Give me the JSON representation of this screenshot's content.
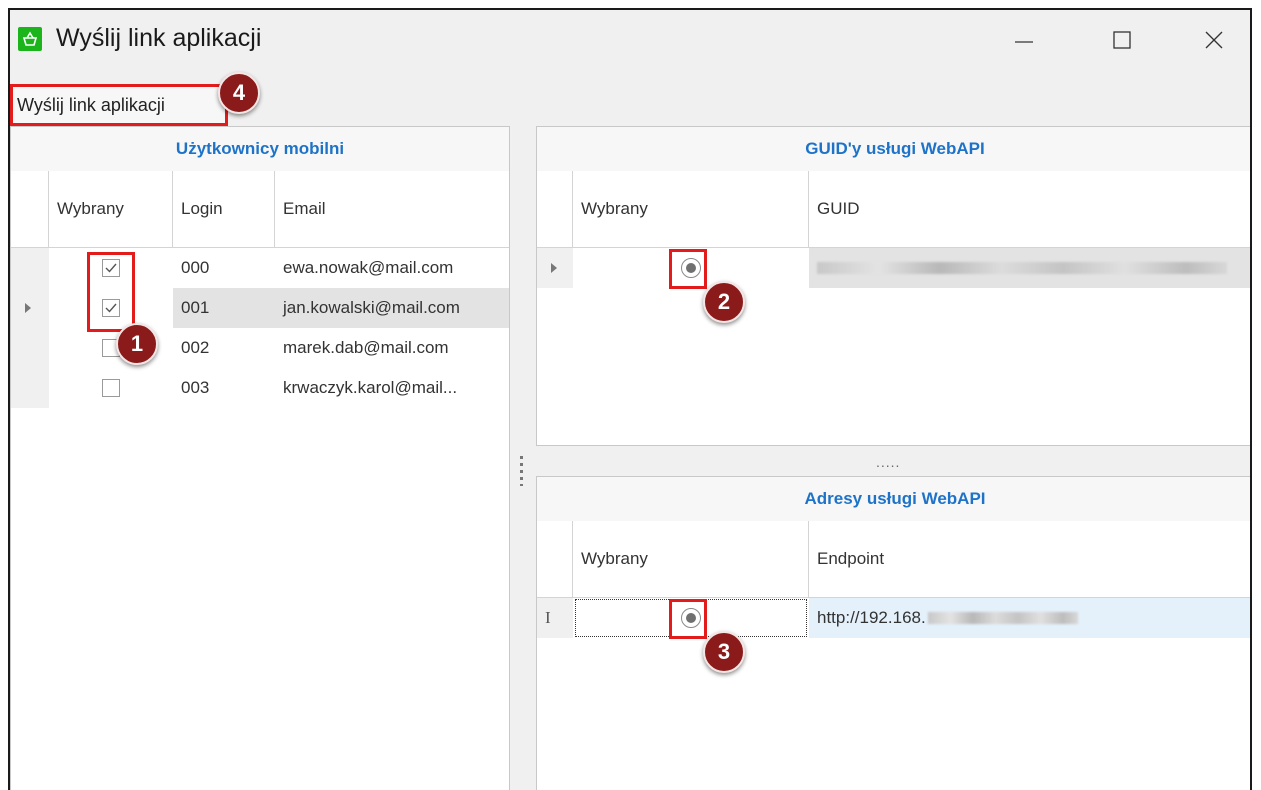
{
  "window": {
    "title": "Wyślij link aplikacji",
    "controls": {
      "minimize": "—",
      "maximize": "☐",
      "close": "✕"
    }
  },
  "toolbar": {
    "send_link_label": "Wyślij link aplikacji"
  },
  "badges": {
    "one": "1",
    "two": "2",
    "three": "3",
    "four": "4"
  },
  "users_panel": {
    "title": "Użytkownicy mobilni",
    "columns": {
      "selected": "Wybrany",
      "login": "Login",
      "email": "Email"
    },
    "rows": [
      {
        "selected": true,
        "login": "000",
        "email": "ewa.nowak@mail.com"
      },
      {
        "selected": true,
        "login": "001",
        "email": "jan.kowalski@mail.com"
      },
      {
        "selected": false,
        "login": "002",
        "email": "marek.dab@mail.com"
      },
      {
        "selected": false,
        "login": "003",
        "email": "krwaczyk.karol@mail..."
      }
    ]
  },
  "guid_panel": {
    "title": "GUID'y usługi WebAPI",
    "columns": {
      "selected": "Wybrany",
      "guid": "GUID"
    }
  },
  "address_panel": {
    "title": "Adresy usługi WebAPI",
    "columns": {
      "selected": "Wybrany",
      "endpoint": "Endpoint"
    },
    "rows": [
      {
        "endpoint_prefix": "http://192.168."
      }
    ]
  },
  "splitter": {
    "grip": "....."
  },
  "colors": {
    "accent_blue": "#1e73c8",
    "highlight_red": "#e31b1b",
    "badge_dark_red": "#8b1a1a",
    "app_icon_green": "#1bb51b"
  }
}
